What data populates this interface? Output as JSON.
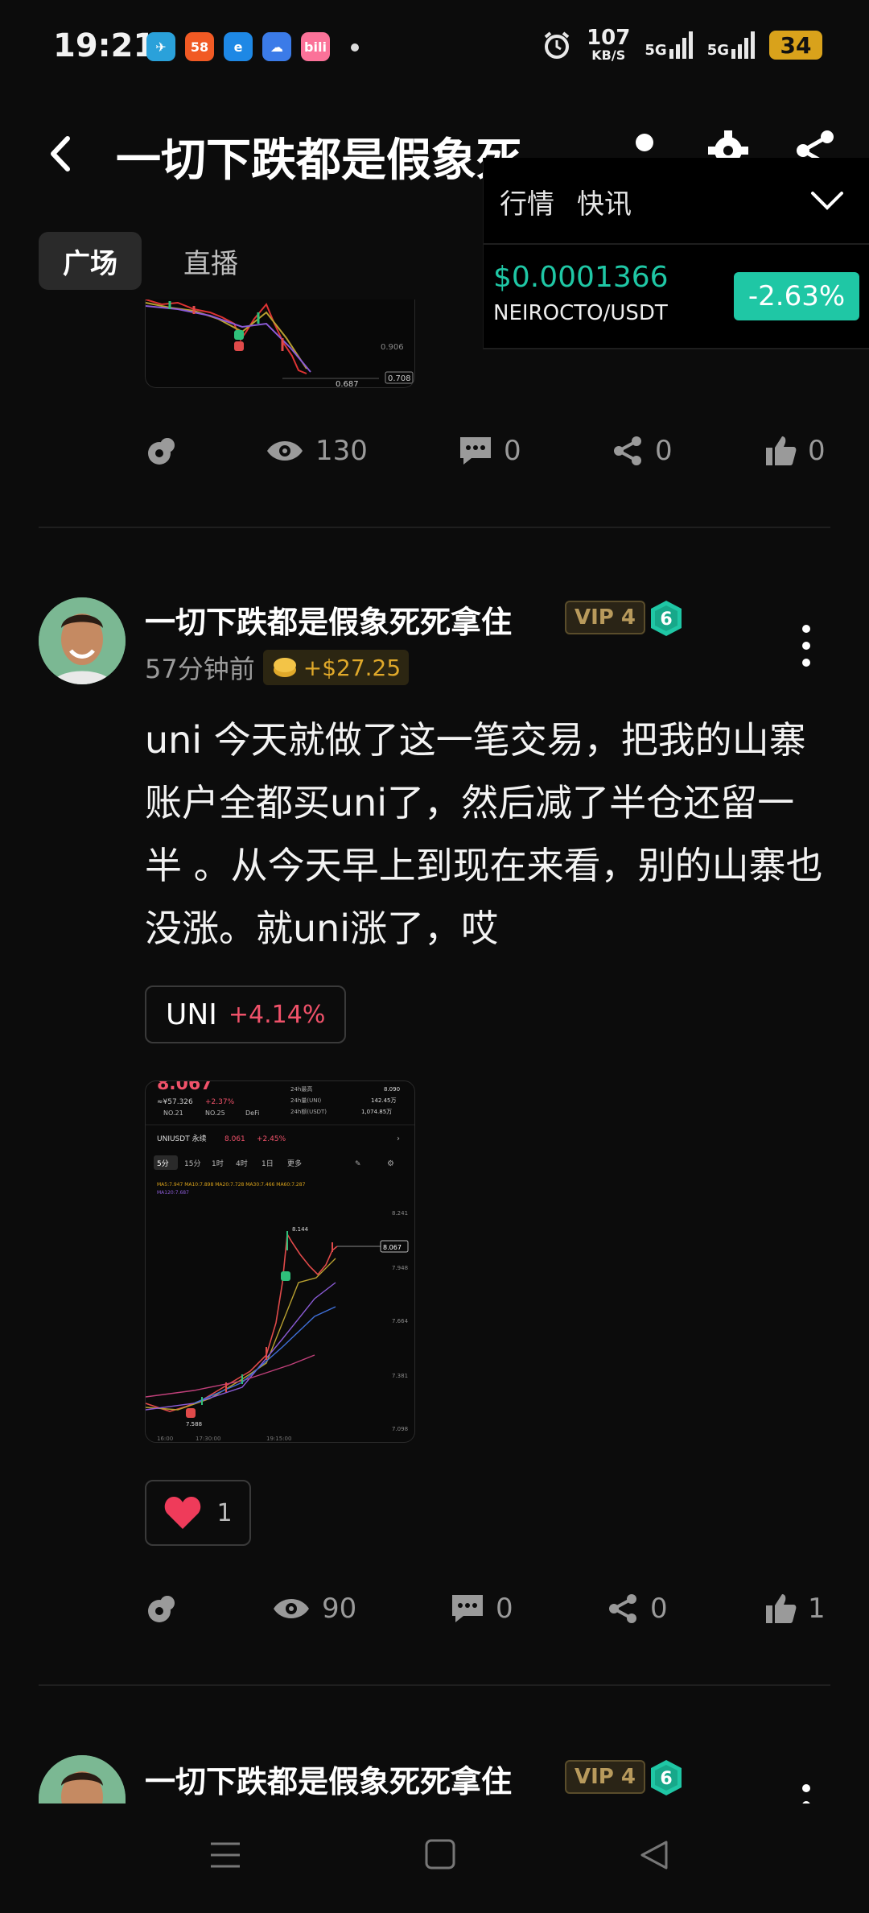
{
  "status_bar": {
    "time": "19:21",
    "app_icons": [
      {
        "name": "telegram-icon",
        "glyph": "✈",
        "color": "#2aa1da"
      },
      {
        "name": "58-app-icon",
        "glyph": "58",
        "color": "#f15a24"
      },
      {
        "name": "browser-app-icon",
        "glyph": "e",
        "color": "#1e88e5"
      },
      {
        "name": "cloud-app-icon",
        "glyph": "☁",
        "color": "#3b7be8"
      },
      {
        "name": "bilibili-icon",
        "glyph": "bili",
        "color": "#fb7299"
      }
    ],
    "net_speed_value": "107",
    "net_speed_unit": "KB/S",
    "sim1": "5G",
    "sim2": "5G",
    "battery": "34"
  },
  "header": {
    "title": "一切下跌都是假象死...",
    "back_label": "‹"
  },
  "tabs": [
    {
      "label": "广场",
      "active": true
    },
    {
      "label": "直播",
      "active": false
    }
  ],
  "market_popup": {
    "tabs": [
      "行情",
      "快讯"
    ],
    "price": "$0.0001366",
    "pair": "NEIROCTO/USDT",
    "change": "-2.63%",
    "change_color": "#1fc7a5"
  },
  "post1_stats": {
    "views": "130",
    "comments": "0",
    "shares": "0",
    "likes": "0"
  },
  "post1_chart_labels": {
    "low": "0.687",
    "mid": "0.906",
    "tag": "0.708"
  },
  "post2": {
    "author": "一切下跌都是假象死死拿住",
    "vip": "VIP 4",
    "level": "6",
    "time_ago": "57分钟前",
    "profit": "+$27.25",
    "text": "uni 今天就做了这一笔交易，把我的山寨账户全都买uni了，然后减了半仓还留一半 。从今天早上到现在来看，别的山寨也没涨。就uni涨了，哎",
    "tag_symbol": "UNI",
    "tag_change": "+4.14%",
    "reaction_count": "1",
    "stats": {
      "views": "90",
      "comments": "0",
      "shares": "0",
      "likes": "1"
    }
  },
  "chart_thumb": {
    "price_header": "8.067",
    "sub_price": "≈¥57.326",
    "sub_change": "+2.37%",
    "rank1": "NO.21",
    "rank2": "NO.25",
    "category": "DeFi",
    "stat_rows": [
      {
        "label": "24h最高",
        "value": "8.090"
      },
      {
        "label": "24h量(UNI)",
        "value": "142.45万"
      },
      {
        "label": "24h额(USDT)",
        "value": "1,074.85万"
      }
    ],
    "pair_line": "UNIUSDT 永续",
    "pair_price": "8.061",
    "pair_change": "+2.45%",
    "timeframes": [
      "5分",
      "15分",
      "1时",
      "4时",
      "1日",
      "更多"
    ],
    "ma_line": "MA5:7.947  MA10:7.898  MA20:7.728  MA30:7.466  MA60:7.287",
    "ma_line2": "MA120:7.687",
    "peak": "8.144",
    "last": "8.067",
    "axis": [
      "8.241",
      "7.948",
      "7.664",
      "7.381",
      "7.098"
    ],
    "low": "7.588",
    "time_axis": [
      "16:00",
      "17:30:00",
      "19:15:00"
    ]
  },
  "post3": {
    "author": "一切下跌都是假象死死拿住",
    "vip": "VIP 4",
    "level": "6"
  }
}
